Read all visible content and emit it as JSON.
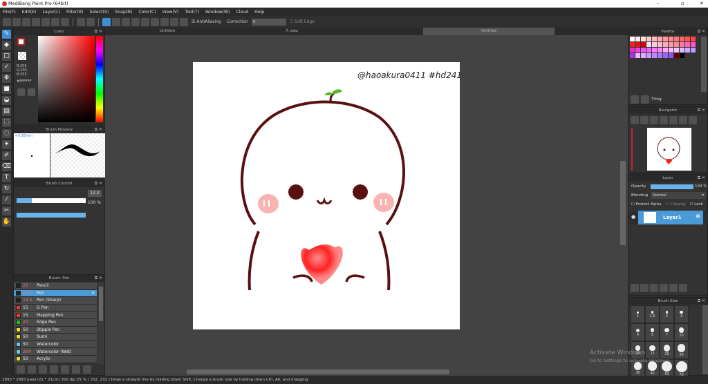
{
  "app": {
    "title": "MediBang Paint Pro (64bit)"
  },
  "menu": [
    "File(F)",
    "Edit(E)",
    "Layer(L)",
    "Filter(R)",
    "Select(S)",
    "Snap(N)",
    "Color(C)",
    "View(V)",
    "Tool(T)",
    "Window(W)",
    "Cloud",
    "Help"
  ],
  "toolbar": {
    "antialiasing": "AntiAliasing",
    "correction_label": "Correction",
    "correction_value": "0",
    "soft_edge": "Soft Edge"
  },
  "tabs": [
    {
      "label": "Untitled"
    },
    {
      "label": "7.mdp"
    },
    {
      "label": "Untitled",
      "active": true
    }
  ],
  "color_panel": {
    "title": "Color",
    "r": "R:255",
    "g": "G:255",
    "b": "B:255",
    "hex": "#FFFFFF"
  },
  "brush_preview": {
    "title": "Brush Preview",
    "size": "0.88mm"
  },
  "brush_control": {
    "title": "Brush Control",
    "size": "12.2",
    "size_fraction": 0.22,
    "opacity": "100 %",
    "opacity_fraction": 1.0
  },
  "brush_list": {
    "title": "Brush: Pen",
    "items": [
      {
        "size": "22",
        "name": "Pencil",
        "color": "#222222"
      },
      {
        "size": "12.2",
        "name": "Pen",
        "color": "#222222",
        "selected": true
      },
      {
        "size": "14.5",
        "name": "Pen (Sharp)",
        "color": "#222222"
      },
      {
        "size": "15",
        "name": "G Pen",
        "color": "#ee3333"
      },
      {
        "size": "15",
        "name": "Mapping Pen",
        "color": "#ee3333"
      },
      {
        "size": "22",
        "name": "Edge Pen",
        "color": "#22bb22"
      },
      {
        "size": "50",
        "name": "Stipple Pen",
        "color": "#eedd22"
      },
      {
        "size": "50",
        "name": "Sumi",
        "color": "#eedd22"
      },
      {
        "size": "50",
        "name": "Watercolor",
        "color": "#66ccee"
      },
      {
        "size": "264",
        "name": "Watercolor (Wet)",
        "color": "#66ccee"
      },
      {
        "size": "50",
        "name": "Acrylic",
        "color": "#eedd22"
      }
    ]
  },
  "palette": {
    "title": "Palette",
    "name": "Tiling"
  },
  "navigator": {
    "title": "Navigator"
  },
  "layer": {
    "title": "Layer",
    "opacity_label": "Opacity",
    "opacity": "100 %",
    "opacity_fraction": 1.0,
    "blending_label": "Blending",
    "blending": "Normal",
    "protect_alpha": "Protect Alpha",
    "clipping": "Clipping",
    "lock": "Lock",
    "layers": [
      {
        "name": "Layer1"
      }
    ]
  },
  "brush_size": {
    "title": "Brush Size",
    "sizes": [
      "1",
      "1.5",
      "2",
      "3",
      "4",
      "5",
      "7",
      "10",
      "12",
      "15",
      "20",
      "30",
      "30",
      "40",
      "50",
      "70"
    ]
  },
  "canvas": {
    "signature": "@haoakura0411  #hd241"
  },
  "status": "2893 * 2893 pixel  (21 * 21cm)  350 dpi  25 %  ( 332, 232 )  Draw a straight line by holding down Shift, Change a brush size by holding down Ctrl, Alt, and dragging",
  "watermark": {
    "line1": "Activate Windows",
    "line2": "Go to Settings to activate Windows."
  }
}
